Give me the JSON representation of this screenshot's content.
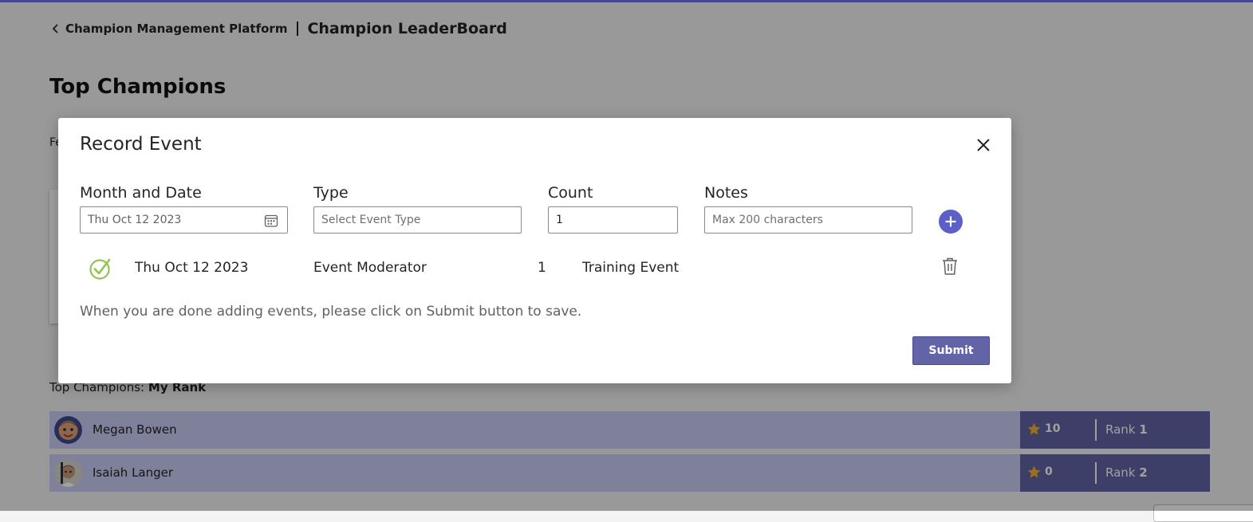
{
  "header": {
    "back_icon": "chevron-left-icon",
    "parent": "Champion Management Platform",
    "current": "Champion LeaderBoard"
  },
  "page": {
    "title": "Top Champions",
    "partial_label": "Fe"
  },
  "leaderboard": {
    "title_prefix": "Top Champions:",
    "title_emphasis": "My Rank",
    "rank_label": "Rank",
    "star_icon": "star-icon",
    "rows": [
      {
        "name": "Megan Bowen",
        "points": "10",
        "rank": "1"
      },
      {
        "name": "Isaiah Langer",
        "points": "0",
        "rank": "2"
      }
    ]
  },
  "dialog": {
    "title": "Record Event",
    "close_icon": "close-icon",
    "columns": {
      "date": "Month and Date",
      "type": "Type",
      "count": "Count",
      "notes": "Notes"
    },
    "date_value": "Thu Oct 12 2023",
    "type_placeholder": "Select Event Type",
    "count_value": "1",
    "notes_placeholder": "Max 200 characters",
    "event": {
      "date": "Thu Oct 12 2023",
      "type": "Event Moderator",
      "count": "1",
      "notes": "Training Event"
    },
    "hint": "When you are done adding events, please click on Submit button to save.",
    "submit_label": "Submit"
  },
  "colors": {
    "brand": "#6264a7",
    "row_background": "#c9cbf2",
    "check": "#92c353",
    "star": "#f2b233"
  }
}
